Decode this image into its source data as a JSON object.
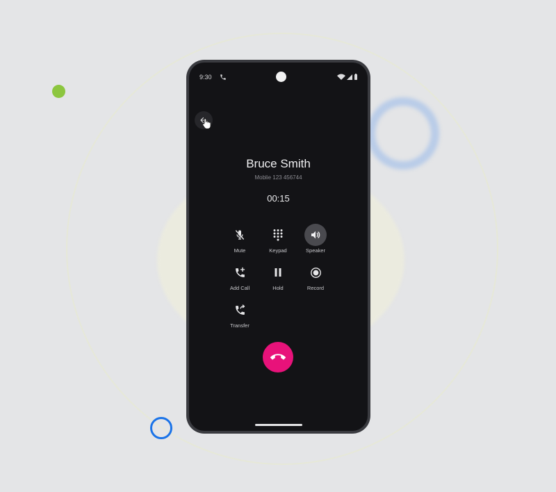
{
  "status_bar": {
    "time": "9:30"
  },
  "call": {
    "caller_name": "Bruce Smith",
    "caller_number": "Moblie 123 456744",
    "timer": "00:15"
  },
  "controls": {
    "mute": "Mute",
    "keypad": "Keypad",
    "speaker": "Speaker",
    "add_call": "Add Call",
    "hold": "Hold",
    "record": "Record",
    "transfer": "Transfer"
  },
  "state": {
    "speaker_active": true
  },
  "colors": {
    "end_call": "#e8127a",
    "screen_bg": "#131316",
    "accent_green": "#8cc63f",
    "accent_blue": "#1a73e8"
  },
  "icons": [
    "phone-icon",
    "wifi-icon",
    "signal-icon",
    "battery-icon",
    "back-arrow-icon",
    "cursor-hand-icon",
    "mic-off-icon",
    "dialpad-icon",
    "volume-icon",
    "add-call-icon",
    "pause-icon",
    "record-icon",
    "transfer-call-icon",
    "call-end-icon"
  ]
}
